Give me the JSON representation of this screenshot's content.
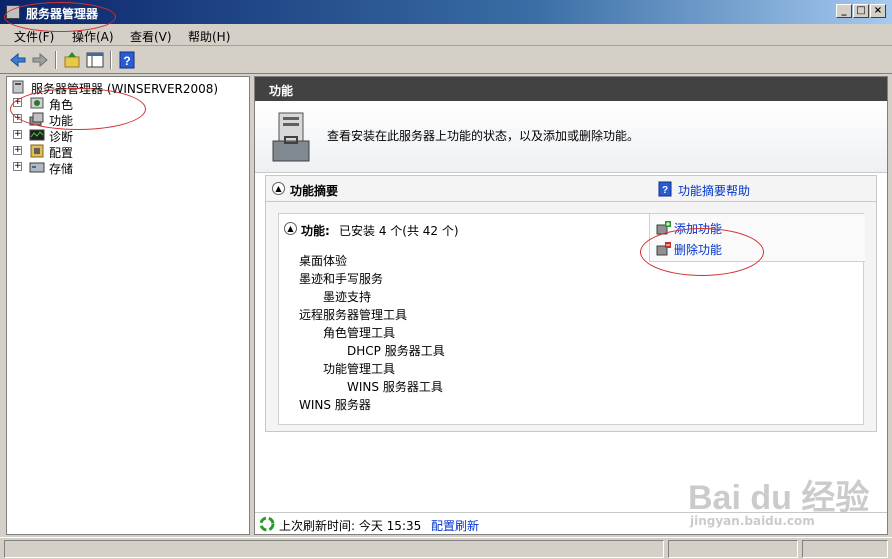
{
  "window": {
    "title": "服务器管理器",
    "min": "_",
    "max": "□",
    "close": "×"
  },
  "menu": [
    "文件(F)",
    "操作(A)",
    "查看(V)",
    "帮助(H)"
  ],
  "tree": {
    "root": "服务器管理器 (WINSERVER2008)",
    "items": [
      "角色",
      "功能",
      "诊断",
      "配置",
      "存储"
    ]
  },
  "panel": {
    "header": "功能",
    "intro": "查看安装在此服务器上功能的状态，以及添加或删除功能。",
    "summary_title": "功能摘要",
    "summary_help": "功能摘要帮助",
    "features_label": "功能:",
    "features_status": "已安装 4 个(共 42 个)",
    "add_link": "添加功能",
    "remove_link": "删除功能",
    "features": [
      {
        "text": "桌面体验",
        "level": 0
      },
      {
        "text": "墨迹和手写服务",
        "level": 0
      },
      {
        "text": "墨迹支持",
        "level": 1
      },
      {
        "text": "远程服务器管理工具",
        "level": 0
      },
      {
        "text": "角色管理工具",
        "level": 1
      },
      {
        "text": "DHCP 服务器工具",
        "level": 2
      },
      {
        "text": "功能管理工具",
        "level": 1
      },
      {
        "text": "WINS 服务器工具",
        "level": 2
      },
      {
        "text": "WINS 服务器",
        "level": 0
      }
    ]
  },
  "footer": {
    "label": "上次刷新时间: 今天 15:35",
    "link": "配置刷新"
  },
  "watermark": {
    "brand": "Bai du 经验",
    "url": "jingyan.baidu.com"
  },
  "colors": {
    "link": "#0033cc",
    "header": "#424242",
    "annotation": "#d03030"
  }
}
